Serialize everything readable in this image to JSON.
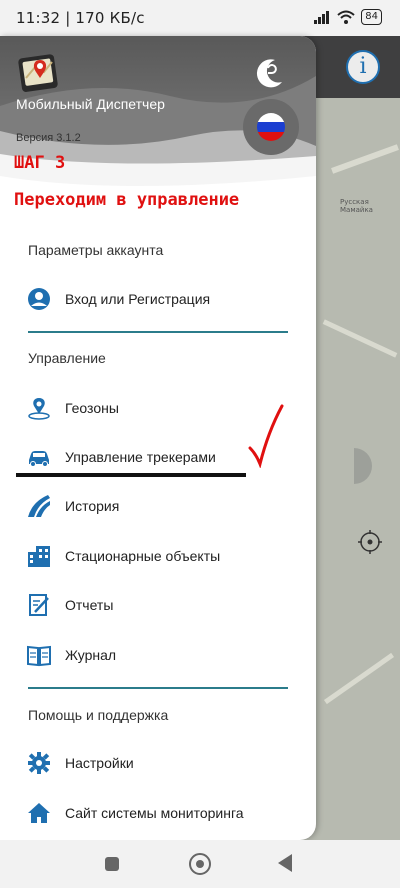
{
  "status_bar": {
    "time_speed": "11:32 | 170 КБ/с",
    "battery": "84",
    "icons": [
      "alarm-off-icon",
      "signal-icon",
      "wifi-icon",
      "battery-icon"
    ]
  },
  "map": {
    "place_label": "Русская Мамайка",
    "info_icon": "info-icon"
  },
  "drawer": {
    "app_title": "Мобильный Диспетчер",
    "app_version": "Версия 3.1.2",
    "overlay_step": "ШАГ 3",
    "overlay_instruction": "Переходим в управление",
    "sections": {
      "account": {
        "title": "Параметры аккаунта",
        "items": [
          {
            "label": "Вход или Регистрация",
            "icon": "account-circle-icon"
          }
        ]
      },
      "management": {
        "title": "Управление",
        "items": [
          {
            "label": "Геозоны",
            "icon": "geofence-pin-icon"
          },
          {
            "label": "Управление трекерами",
            "icon": "car-icon"
          },
          {
            "label": "История",
            "icon": "road-history-icon"
          },
          {
            "label": "Стационарные объекты",
            "icon": "building-icon"
          },
          {
            "label": "Отчеты",
            "icon": "report-icon"
          },
          {
            "label": "Журнал",
            "icon": "journal-book-icon"
          }
        ]
      },
      "help": {
        "title": "Помощь и поддержка",
        "items": [
          {
            "label": "Настройки",
            "icon": "gear-icon"
          },
          {
            "label": "Сайт системы мониторинга",
            "icon": "home-icon"
          }
        ]
      }
    }
  },
  "colors": {
    "accent": "#1f6fb0",
    "divider": "#2b7c8b",
    "annotation_red": "#e01010"
  }
}
